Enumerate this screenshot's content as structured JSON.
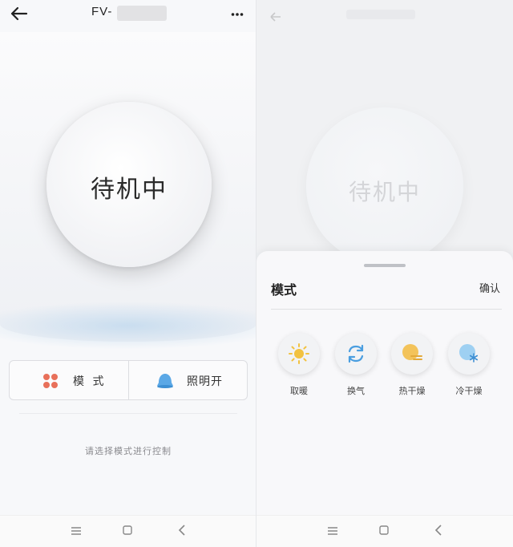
{
  "left": {
    "header": {
      "title": "FV-",
      "back_icon": "back-arrow-icon",
      "more_icon": "more-dots-icon"
    },
    "status": "待机中",
    "controls": {
      "mode": {
        "label": "模 式",
        "icon": "mode-dots-icon",
        "icon_color": "#e8705a"
      },
      "light": {
        "label": "照明开",
        "icon": "bell-light-icon",
        "icon_color": "#5ba8e6"
      }
    },
    "hint": "请选择模式进行控制"
  },
  "right": {
    "background_status": "待机中",
    "sheet": {
      "title": "模式",
      "confirm": "确认",
      "options": [
        {
          "label": "取暖",
          "icon": "sun-icon",
          "color": "#f2c240"
        },
        {
          "label": "换气",
          "icon": "refresh-arrows-icon",
          "color": "#4a9ee0"
        },
        {
          "label": "热干燥",
          "icon": "warm-dry-icon",
          "color": "#f3c35a"
        },
        {
          "label": "冷干燥",
          "icon": "cool-dry-icon",
          "color": "#5ab0e8"
        }
      ]
    }
  },
  "navbar": {
    "menu_icon": "menu-icon",
    "home_icon": "home-icon",
    "back_icon": "nav-back-icon"
  }
}
